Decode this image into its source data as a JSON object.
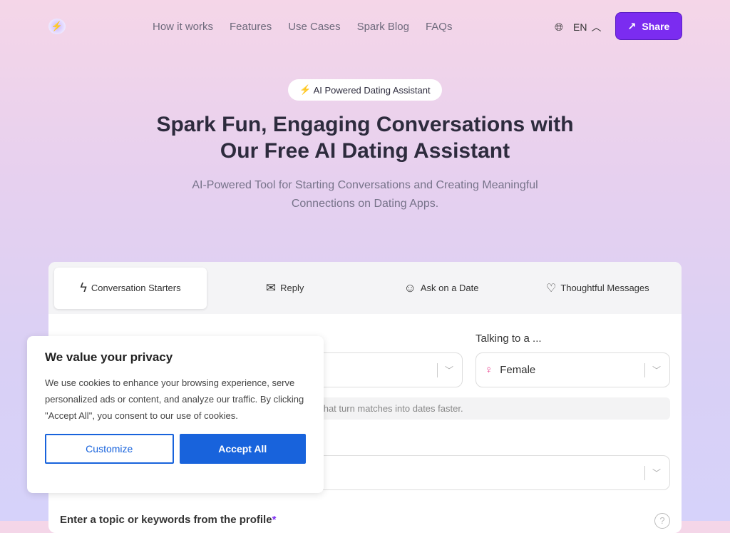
{
  "nav": {
    "links": [
      "How it works",
      "Features",
      "Use Cases",
      "Spark Blog",
      "FAQs"
    ],
    "lang": "EN",
    "share": "Share"
  },
  "hero": {
    "badge": "AI Powered Dating Assistant",
    "title_line1": "Spark Fun, Engaging Conversations with",
    "title_line2": "Our Free AI Dating Assistant",
    "subtitle_line1": "AI-Powered Tool for Starting Conversations and Creating Meaningful",
    "subtitle_line2": "Connections on Dating Apps."
  },
  "tabs": [
    {
      "label": "Conversation Starters",
      "icon": "lightning-icon"
    },
    {
      "label": "Reply",
      "icon": "mail-reply-icon"
    },
    {
      "label": "Ask on a Date",
      "icon": "smiley-icon"
    },
    {
      "label": "Thoughtful Messages",
      "icon": "hearts-icon"
    }
  ],
  "form": {
    "talking_to_label": "Talking to a ...",
    "talking_to_value": "Female",
    "hint_visible": "s that turn matches into dates faster.",
    "topic_label": "Enter a topic or keywords from the profile",
    "required": "*"
  },
  "cookie": {
    "title": "We value your privacy",
    "body": "We use cookies to enhance your browsing experience, serve personalized ads or content, and analyze our traffic. By clicking \"Accept All\", you consent to our use of cookies.",
    "customize": "Customize",
    "accept": "Accept All"
  },
  "colors": {
    "accent": "#7b2cf0",
    "cookie_blue": "#1863dc",
    "female": "#e83e8c"
  }
}
